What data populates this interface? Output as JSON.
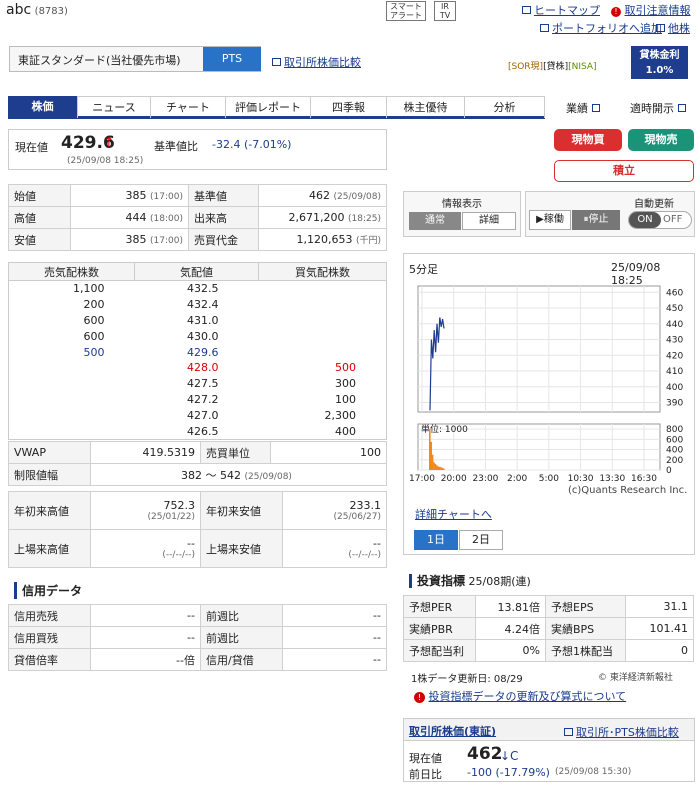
{
  "header": {
    "stock_name": "abc",
    "code": "(8783)",
    "icon_smart_alert": "スマート\nアラート",
    "icon_irtv": "IR\nTV",
    "link_heatmap": "ヒートマップ",
    "link_caution": "取引注意情報",
    "link_portfolio": "ポートフォリオへ追加",
    "link_other": "他株"
  },
  "market": {
    "tse_label": "東証スタンダード(当社優先市場)",
    "pts_label": "PTS",
    "compare_link": "取引所株価比較",
    "tags": [
      "[SOR現]",
      "[貸株]",
      "[NISA]"
    ],
    "interest_label": "貸株金利",
    "interest_value": "1.0%"
  },
  "tabs": [
    "株価",
    "ニュース",
    "チャート",
    "評価レポート",
    "四季報",
    "株主優待",
    "分析"
  ],
  "right_links": [
    "業績",
    "適時開示"
  ],
  "price": {
    "label": "現在値",
    "value": "429.6",
    "arrow": "↑",
    "time": "(25/09/08 18:25)",
    "change_label": "基準値比",
    "change": "-32.4 (-7.01%)"
  },
  "trade_buttons": {
    "buy": "現物買",
    "sell": "現物売",
    "reserve": "積立"
  },
  "stats": [
    {
      "l1": "始値",
      "v1": "385",
      "t1": "(17:00)",
      "l2": "基準値",
      "v2": "462",
      "t2": "(25/09/08)"
    },
    {
      "l1": "高値",
      "v1": "444",
      "t1": "(18:00)",
      "l2": "出来高",
      "v2": "2,671,200",
      "t2": "(18:25)"
    },
    {
      "l1": "安値",
      "v1": "385",
      "t1": "(17:00)",
      "l2": "売買代金",
      "v2": "1,120,653",
      "t2": "(千円)"
    }
  ],
  "info_display": {
    "title": "情報表示",
    "normal": "通常",
    "detail": "詳細"
  },
  "auto_update": {
    "title": "自動更新",
    "running": "稼働",
    "stop": "停止",
    "on": "ON",
    "off": "OFF"
  },
  "orderbook": {
    "headers": [
      "売気配株数",
      "気配値",
      "買気配株数"
    ],
    "rows": [
      {
        "sell": "1,100",
        "price": "432.5",
        "buy": ""
      },
      {
        "sell": "200",
        "price": "432.4",
        "buy": ""
      },
      {
        "sell": "600",
        "price": "431.0",
        "buy": ""
      },
      {
        "sell": "600",
        "price": "430.0",
        "buy": ""
      },
      {
        "sell": "500",
        "price": "429.6",
        "buy": ""
      },
      {
        "sell": "",
        "price": "428.0",
        "buy": "500"
      },
      {
        "sell": "",
        "price": "427.5",
        "buy": "300"
      },
      {
        "sell": "",
        "price": "427.2",
        "buy": "100"
      },
      {
        "sell": "",
        "price": "427.0",
        "buy": "2,300"
      },
      {
        "sell": "",
        "price": "426.5",
        "buy": "400"
      }
    ]
  },
  "vwap": {
    "vwap_label": "VWAP",
    "vwap_value": "419.5319",
    "unit_label": "売買単位",
    "unit_value": "100",
    "limit_label": "制限値幅",
    "limit_value": "382 〜 542",
    "limit_date": "(25/09/08)"
  },
  "highs": {
    "ytd_high_label": "年初来高値",
    "ytd_high": "752.3",
    "ytd_high_date": "(25/01/22)",
    "ytd_low_label": "年初来安値",
    "ytd_low": "233.1",
    "ytd_low_date": "(25/06/27)",
    "list_high_label": "上場来高値",
    "list_high": "--",
    "list_high_date": "(--/--/--)",
    "list_low_label": "上場来安値",
    "list_low": "--",
    "list_low_date": "(--/--/--)"
  },
  "margin": {
    "title": "信用データ",
    "rows": [
      {
        "l1": "信用売残",
        "v1": "--",
        "l2": "前週比",
        "v2": "--"
      },
      {
        "l1": "信用買残",
        "v1": "--",
        "l2": "前週比",
        "v2": "--"
      },
      {
        "l1": "貸借倍率",
        "v1": "--倍",
        "l2": "信用/貸借",
        "v2": "--"
      }
    ]
  },
  "chart": {
    "interval": "5分足",
    "timestamp": "25/09/08 18:25",
    "volume_label": "単位: 1000",
    "copyright": "(c)Quants Research Inc.",
    "detail_link": "詳細チャートへ",
    "btn_1d": "1日",
    "btn_2d": "2日"
  },
  "chart_data": {
    "type": "line",
    "y_ticks": [
      "460",
      "450",
      "440",
      "430",
      "420",
      "410",
      "400",
      "390"
    ],
    "ylim": [
      384,
      464
    ],
    "vol_ticks": [
      "800",
      "600",
      "400",
      "200",
      "0"
    ],
    "vol_ylim": [
      0,
      900
    ],
    "x_ticks": [
      "17:00",
      "20:00",
      "23:00",
      "2:00",
      "5:00",
      "10:30",
      "13:30",
      "16:30"
    ],
    "price_series": [
      385,
      430,
      418,
      436,
      422,
      440,
      428,
      444,
      438,
      443,
      437
    ],
    "volume_series": [
      800,
      550,
      300,
      150,
      120,
      90,
      70,
      60,
      55,
      40,
      30
    ]
  },
  "indicators": {
    "title": "投資指標",
    "period": "25/08期(連)",
    "rows": [
      {
        "l1": "予想PER",
        "v1": "13.81倍",
        "l2": "予想EPS",
        "v2": "31.1"
      },
      {
        "l1": "実績PBR",
        "v1": "4.24倍",
        "l2": "実績BPS",
        "v2": "101.41"
      },
      {
        "l1": "予想配当利",
        "v1": "0%",
        "l2": "予想1株配当",
        "v2": "0"
      }
    ],
    "update_date": "1株データ更新日: 08/29",
    "source": "© 東洋経済新報社",
    "notice_link": "投資指標データの更新及び算式について"
  },
  "exchange_price": {
    "title": "取引所株価(東証)",
    "compare_link": "取引所･PTS株価比較",
    "current_label": "現在値",
    "current_value": "462",
    "current_suffix": "↓C",
    "change_label": "前日比",
    "change_value": "-100 (-17.79%)",
    "change_time": "(25/09/08 15:30)"
  }
}
